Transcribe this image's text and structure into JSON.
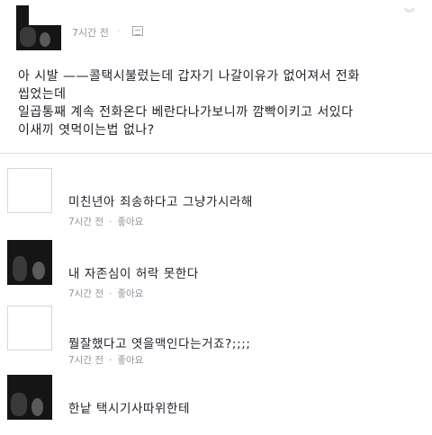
{
  "post": {
    "time": "7시간 전",
    "separator": "·",
    "lines": [
      "아 시발 ——콜택시불렀는데 갑자기 나갈이유가 없어져서 전화",
      "씹었는데",
      "일곱통째 계속 전화온다 베란다나가보니까 깜빡이키고 서있다",
      "이새끼 엿먹이는법 없나?"
    ]
  },
  "comments": [
    {
      "text": "미친년아 죄송하다고 그냥가시라해",
      "time": "7시간 전",
      "dot": "·",
      "like": "좋아요"
    },
    {
      "text": "내 자존심이 허락 못한다",
      "time": "7시간 전",
      "dot": "·",
      "like": "좋아요"
    },
    {
      "text": "뭘잘했다고 엿을맥인다는거죠?;;;;",
      "time": "7시간 전",
      "dot": "·",
      "like": "좋아요"
    },
    {
      "text": "한낱 택시기사따위한테",
      "time": "",
      "dot": "",
      "like": ""
    }
  ]
}
